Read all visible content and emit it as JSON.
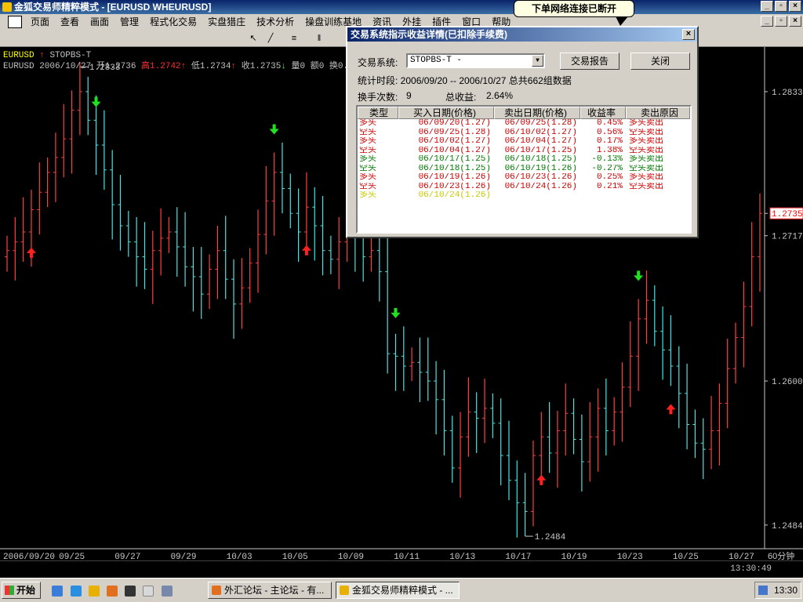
{
  "window": {
    "title": "金狐交易师精粹模式 - [EURUSD WHEURUSD]"
  },
  "balloon": {
    "text": "下单网络连接已断开"
  },
  "menu": {
    "items": [
      "页面",
      "查看",
      "画面",
      "管理",
      "程式化交易",
      "实盘猎庄",
      "技术分析",
      "操盘训练基地",
      "资讯",
      "外挂",
      "插件",
      "窗口",
      "帮助"
    ]
  },
  "chart_header": {
    "symbol": "EURUSD",
    "indicator": "STOPBS-T",
    "row2_prefix": "EURUSD 2006/10/27 开1.2736",
    "high_label": "高1.2742",
    "low_label": "低1.2734",
    "close_label": "收1.2735",
    "vol_label": "量0 额0 换0.00%"
  },
  "chart_data": {
    "type": "candlestick",
    "ylim": [
      1.247,
      1.285
    ],
    "x_ticks": [
      "2006/09/20",
      "09/25",
      "09/27",
      "09/29",
      "10/03",
      "10/05",
      "10/09",
      "10/11",
      "10/13",
      "10/17",
      "10/19",
      "10/23",
      "10/25",
      "10/27"
    ],
    "y_ticks": [
      "1.2833",
      "1.2735",
      "1.2717",
      "1.2600",
      "1.2484"
    ],
    "period_label": "60分钟",
    "high_annotation": "1.2833",
    "low_annotation": "1.2484",
    "last_price": "1.2735",
    "series": [
      {
        "values": [
          1.2705,
          1.2712,
          1.272,
          1.2738,
          1.2752,
          1.2768,
          1.278,
          1.2795,
          1.2818,
          1.2833,
          1.281,
          1.279,
          1.277,
          1.2742,
          1.2725,
          1.2712,
          1.27,
          1.269,
          1.2705,
          1.2715,
          1.272,
          1.2708,
          1.2692,
          1.2684,
          1.267,
          1.269,
          1.2705,
          1.2682,
          1.2662,
          1.2675,
          1.2695,
          1.2718,
          1.2745,
          1.2768,
          1.2755,
          1.2735,
          1.272,
          1.274,
          1.2725,
          1.2705,
          1.2698,
          1.2712,
          1.273,
          1.2716,
          1.27,
          1.2705,
          1.2688,
          1.2622,
          1.262,
          1.2612,
          1.2615,
          1.2607,
          1.26,
          1.2585,
          1.256,
          1.253,
          1.2555,
          1.2575,
          1.257,
          1.2578,
          1.2566,
          1.254,
          1.252,
          1.2502,
          1.2495,
          1.254,
          1.2555,
          1.2542,
          1.256,
          1.2574,
          1.2553,
          1.2535,
          1.2555,
          1.2578,
          1.256,
          1.2575,
          1.2595,
          1.262,
          1.265,
          1.2665,
          1.264,
          1.2625,
          1.2612,
          1.259,
          1.2565,
          1.255,
          1.2545,
          1.256,
          1.2582,
          1.261,
          1.2635,
          1.266,
          1.27,
          1.2735
        ]
      }
    ],
    "signals": [
      {
        "type": "up",
        "label": "多"
      },
      {
        "type": "down",
        "label": "空"
      },
      {
        "type": "down",
        "label": "空"
      },
      {
        "type": "up",
        "label": "多"
      },
      {
        "type": "down",
        "label": "空"
      },
      {
        "type": "up",
        "label": "多"
      },
      {
        "type": "down",
        "label": "空"
      },
      {
        "type": "up",
        "label": "多"
      }
    ]
  },
  "dialog": {
    "title": "交易系统指示收益详情(已扣除手续费)",
    "system_label": "交易系统:",
    "system_value": "STOPBS-T -",
    "report_button": "交易报告",
    "close_button": "关闭",
    "period_text": "统计时段: 2006/09/20 -- 2006/10/27 总共662组数据",
    "turnover_label": "换手次数:",
    "turnover_value": "9",
    "total_label": "总收益:",
    "total_value": "2.64%",
    "columns": [
      "类型",
      "买入日期(价格)",
      "卖出日期(价格)",
      "收益率",
      "卖出原因"
    ],
    "rows": [
      {
        "type": "多头",
        "buy": "06/09/20(1.27)",
        "sell": "06/09/25(1.28)",
        "ret": "0.45%",
        "reason": "多头卖出",
        "color": "#cc0000"
      },
      {
        "type": "空头",
        "buy": "06/09/25(1.28)",
        "sell": "06/10/02(1.27)",
        "ret": "0.56%",
        "reason": "空头卖出",
        "color": "#cc0000"
      },
      {
        "type": "多头",
        "buy": "06/10/02(1.27)",
        "sell": "06/10/04(1.27)",
        "ret": "0.17%",
        "reason": "多头卖出",
        "color": "#cc0000"
      },
      {
        "type": "空头",
        "buy": "06/10/04(1.27)",
        "sell": "06/10/17(1.25)",
        "ret": "1.38%",
        "reason": "空头卖出",
        "color": "#cc0000"
      },
      {
        "type": "多头",
        "buy": "06/10/17(1.25)",
        "sell": "06/10/18(1.25)",
        "ret": "-0.13%",
        "reason": "多头卖出",
        "color": "#007700"
      },
      {
        "type": "空头",
        "buy": "06/10/18(1.25)",
        "sell": "06/10/19(1.26)",
        "ret": "-0.27%",
        "reason": "空头卖出",
        "color": "#007700"
      },
      {
        "type": "多头",
        "buy": "06/10/19(1.26)",
        "sell": "06/10/23(1.26)",
        "ret": "0.25%",
        "reason": "多头卖出",
        "color": "#cc0000"
      },
      {
        "type": "空头",
        "buy": "06/10/23(1.26)",
        "sell": "06/10/24(1.26)",
        "ret": "0.21%",
        "reason": "空头卖出",
        "color": "#cc0000"
      },
      {
        "type": "多头",
        "buy": "06/10/24(1.26)",
        "sell": "",
        "ret": "",
        "reason": "",
        "color": "#c8c800"
      }
    ]
  },
  "status": {
    "time": "13:30:49"
  },
  "taskbar": {
    "start_label": "开始",
    "tasks": [
      "外汇论坛 - 主论坛 - 有...",
      "金狐交易师精粹模式 - ..."
    ],
    "clock": "13:30"
  }
}
